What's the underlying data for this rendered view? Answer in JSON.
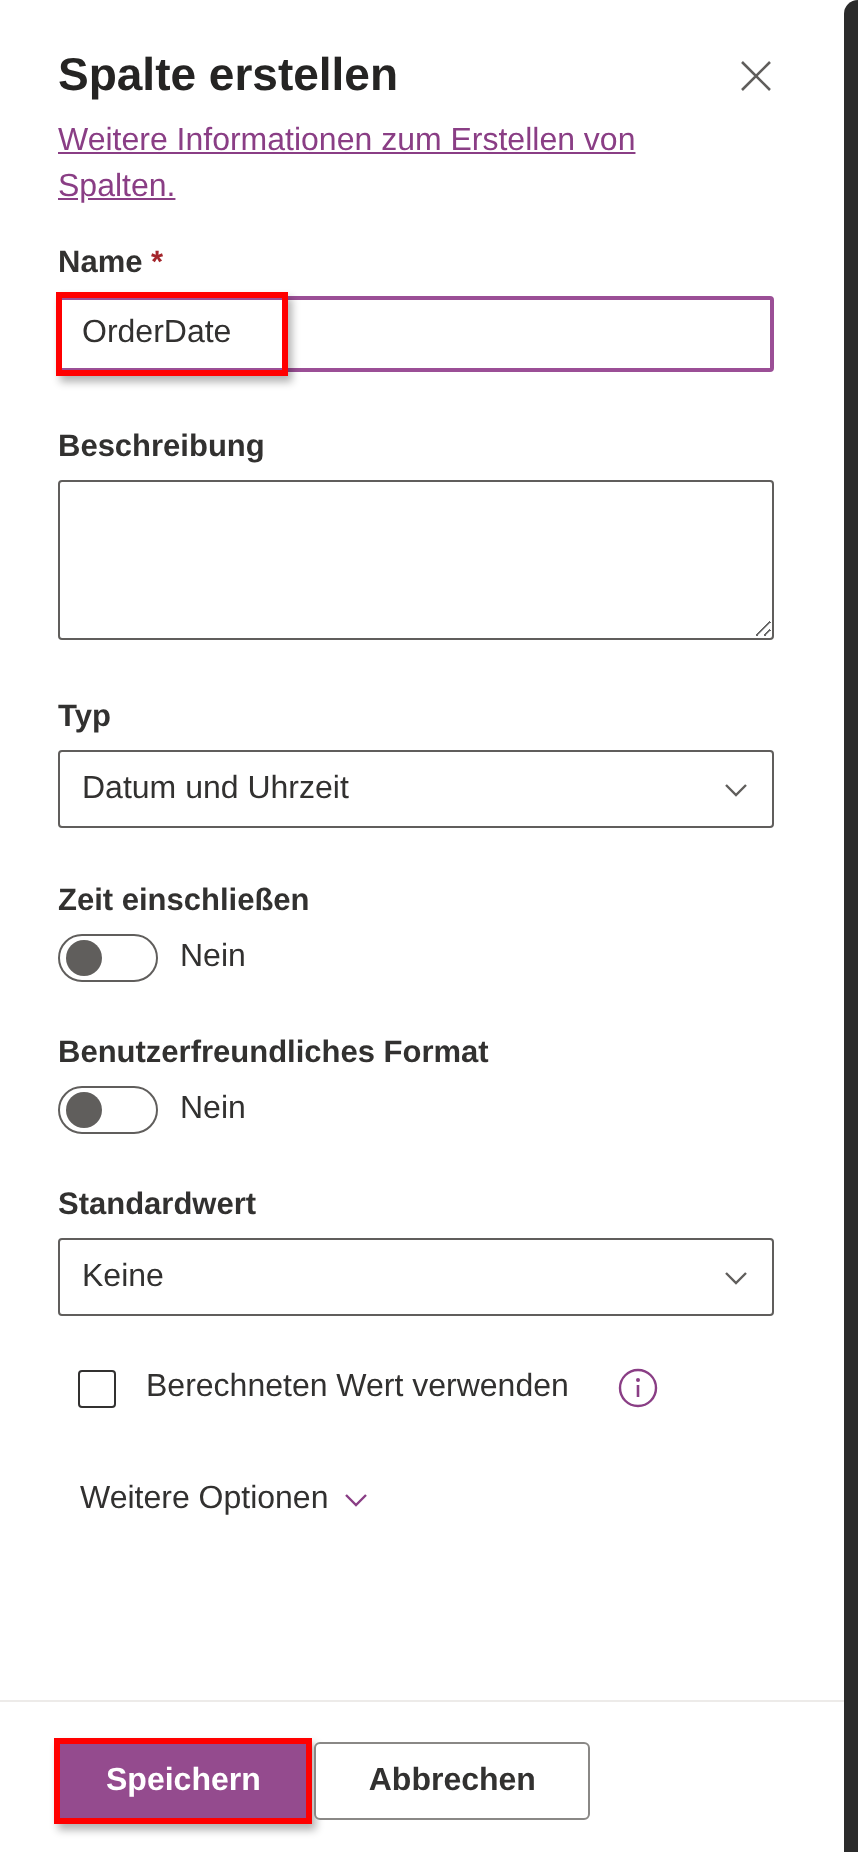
{
  "panel": {
    "title": "Spalte erstellen",
    "info_link": "Weitere Informationen zum Erstellen von Spalten."
  },
  "fields": [
    {
      "kind": "text",
      "label": "Name",
      "required_mark": "*",
      "value": "OrderDate",
      "focused": true,
      "highlighted": true
    },
    {
      "kind": "textarea",
      "label": "Beschreibung"
    },
    {
      "kind": "select",
      "label": "Typ",
      "value": "Datum und Uhrzeit"
    },
    {
      "kind": "toggle",
      "label": "Zeit einschließen",
      "on": false,
      "state_text": "Nein"
    },
    {
      "kind": "toggle",
      "label": "Benutzerfreundliches Format",
      "on": false,
      "state_text": "Nein"
    },
    {
      "kind": "select",
      "label": "Standardwert",
      "value": "Keine"
    },
    {
      "kind": "checkbox",
      "label": "Berechneten Wert verwenden",
      "checked": false
    },
    {
      "kind": "expander",
      "label": "Weitere Optionen",
      "expanded": false
    }
  ],
  "buttons": [
    {
      "label": "Speichern",
      "primary": true,
      "highlighted": true
    },
    {
      "label": "Abbrechen",
      "primary": false,
      "highlighted": false
    }
  ]
}
